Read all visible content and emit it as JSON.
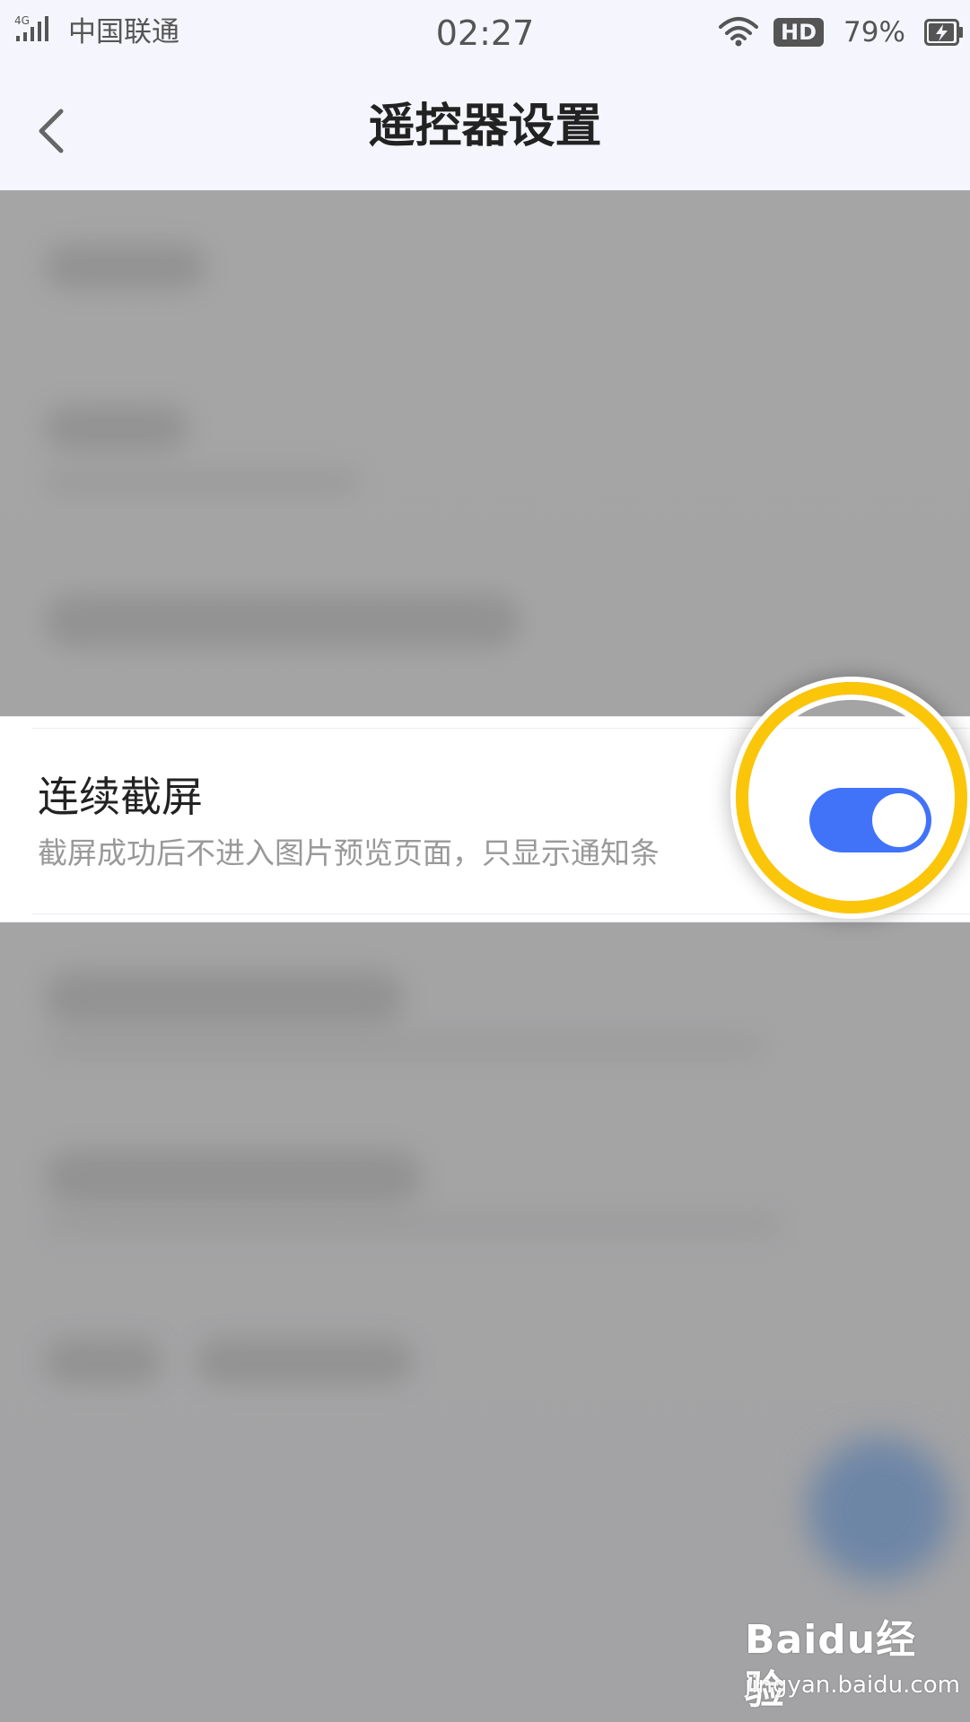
{
  "status_bar": {
    "network": "4G",
    "carrier": "中国联通",
    "time": "02:27",
    "hd_badge": "HD",
    "battery_percent": "79%",
    "icons": [
      "signal-icon",
      "wifi-icon",
      "battery-charging-icon"
    ]
  },
  "header": {
    "title": "遥控器设置",
    "back_icon": "chevron-left-icon"
  },
  "setting": {
    "title": "连续截屏",
    "description": "截屏成功后不进入图片预览页面，只显示通知条",
    "enabled": true
  },
  "colors": {
    "accent": "#4173f9",
    "highlight_ring": "#fbc60a",
    "header_bg": "#f5f6fd",
    "overlay_bg": "#a3a3a5"
  },
  "watermark": {
    "logo": "Baidu经验",
    "url": "jingyan.baidu.com"
  }
}
